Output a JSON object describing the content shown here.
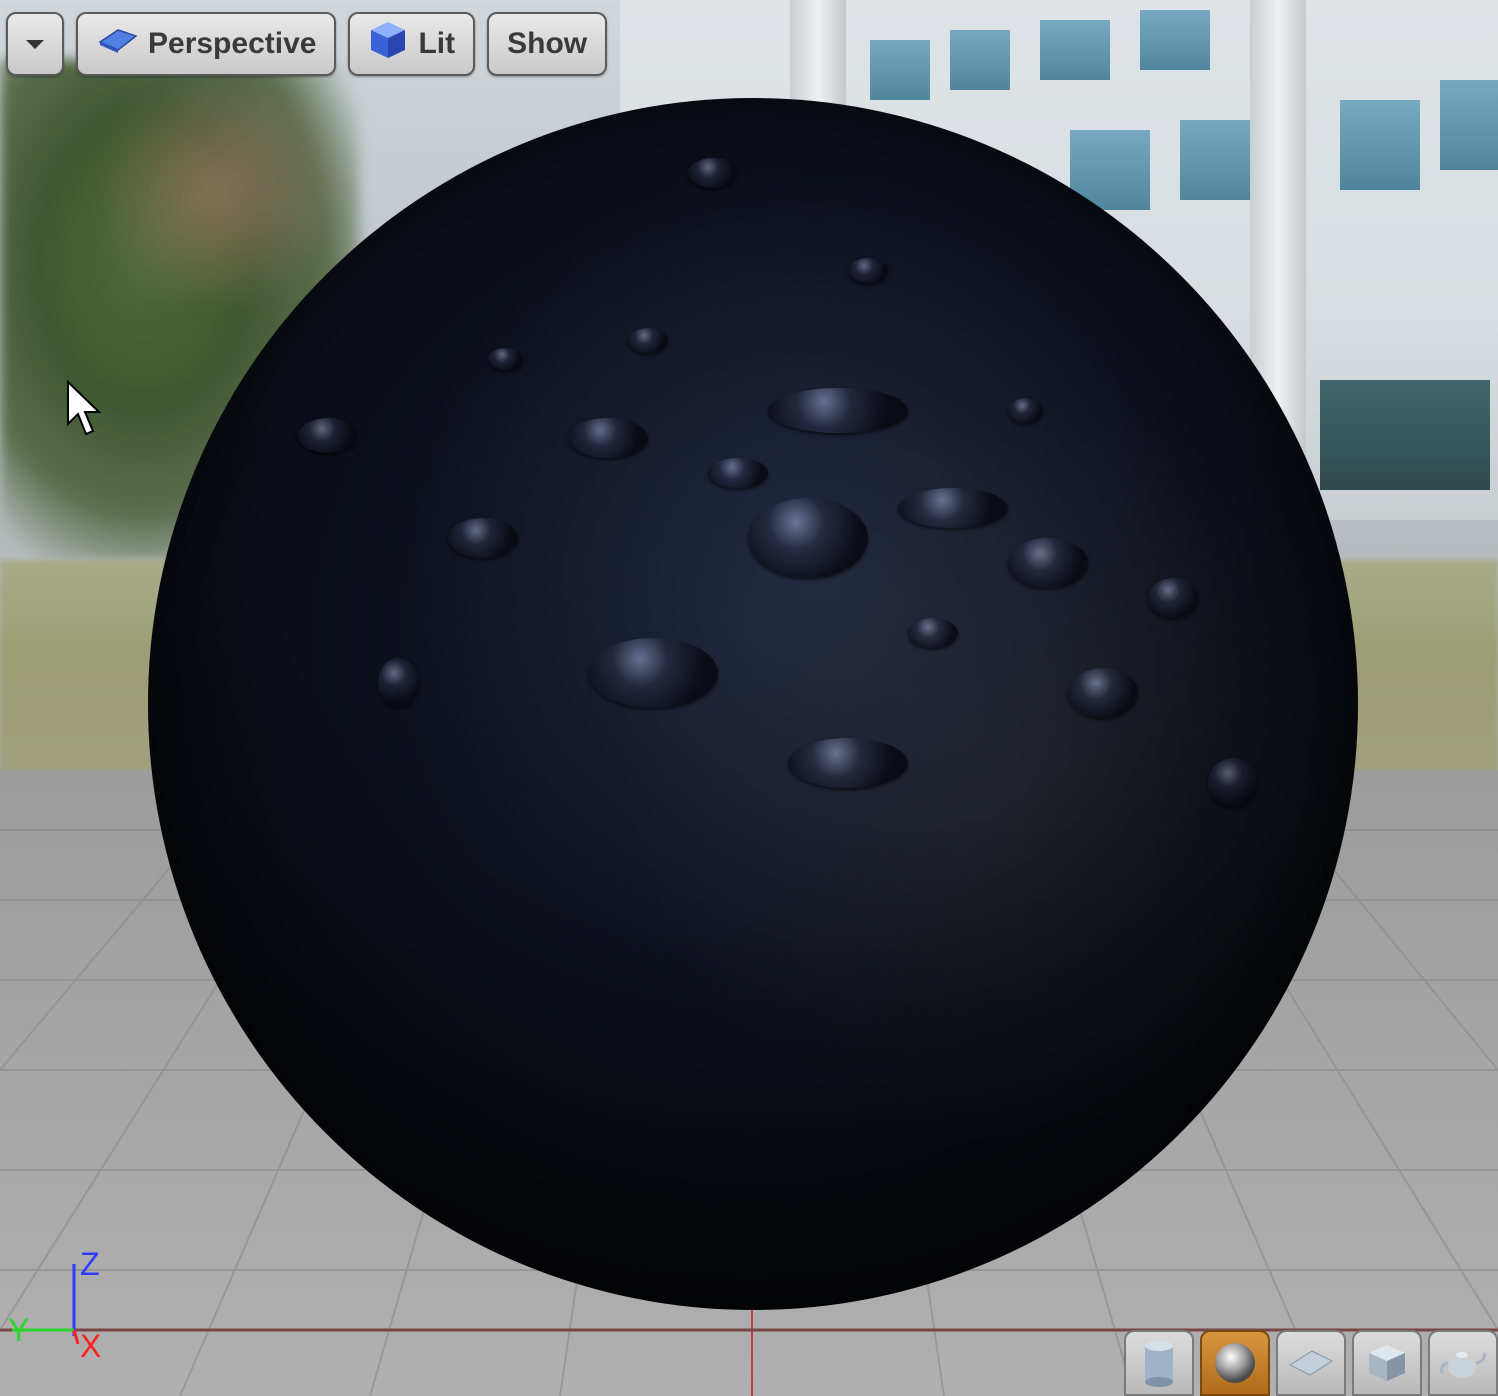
{
  "toolbar": {
    "view_options_label": "",
    "perspective_label": "Perspective",
    "lit_label": "Lit",
    "show_label": "Show"
  },
  "axis_gizmo": {
    "z": "Z",
    "y": "Y",
    "x": "X"
  },
  "preview_shapes": [
    {
      "name": "cylinder",
      "active": false
    },
    {
      "name": "sphere",
      "active": true
    },
    {
      "name": "plane",
      "active": false
    },
    {
      "name": "cube",
      "active": false
    },
    {
      "name": "teapot",
      "active": false
    }
  ],
  "colors": {
    "axis_z": "#2b3cff",
    "axis_y": "#2bd62b",
    "axis_x": "#ff2020",
    "active_shape": "#c98431"
  }
}
